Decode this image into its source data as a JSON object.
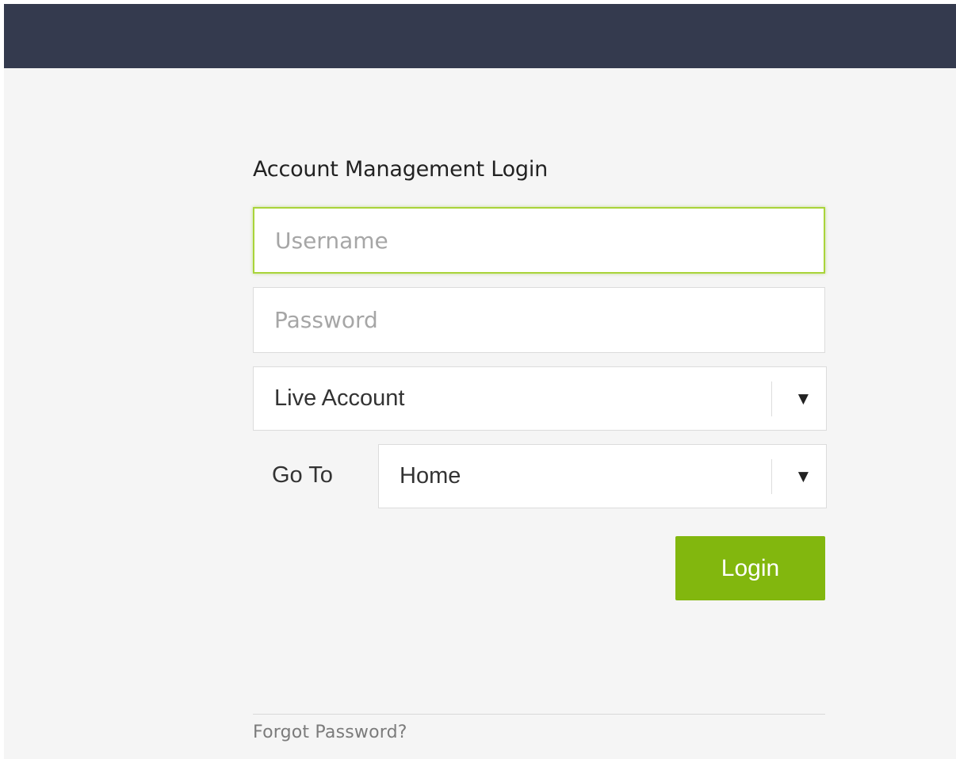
{
  "header": {
    "background_color": "#343a4e"
  },
  "login": {
    "title": "Account Management Login",
    "username": {
      "value": "",
      "placeholder": "Username"
    },
    "password": {
      "value": "",
      "placeholder": "Password"
    },
    "account_type": {
      "selected": "Live Account"
    },
    "goto": {
      "label": "Go To",
      "selected": "Home"
    },
    "submit_label": "Login",
    "forgot_password": "Forgot Password?"
  },
  "icons": {
    "dropdown": "chevron-down-icon"
  },
  "colors": {
    "accent": "#82b70e",
    "focus_border": "#a9d43a",
    "page_background": "#f5f5f5"
  }
}
